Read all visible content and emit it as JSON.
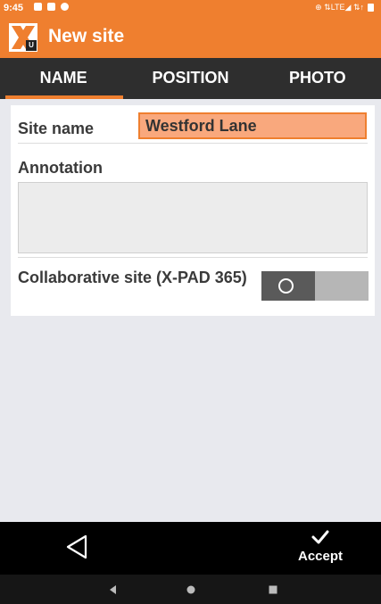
{
  "status_bar": {
    "time": "9:45",
    "right_text": "⊕ ⇅LTE◢ ⇅↑"
  },
  "app_bar": {
    "title": "New site",
    "logo_badge": "U"
  },
  "tabs": [
    {
      "label": "NAME",
      "active": true
    },
    {
      "label": "POSITION",
      "active": false
    },
    {
      "label": "PHOTO",
      "active": false
    }
  ],
  "form": {
    "site_name_label": "Site name",
    "site_name_value": "Westford Lane",
    "annotation_label": "Annotation",
    "annotation_value": "",
    "collaborative_label": "Collaborative site (X-PAD 365)",
    "collaborative_enabled": false
  },
  "actions": {
    "accept_label": "Accept",
    "back_icon": "back-triangle-icon",
    "accept_icon": "checkmark-icon"
  },
  "colors": {
    "brand_orange": "#ef7f2f",
    "input_highlight": "#f9a87d",
    "tab_bar": "#2e2e2e",
    "background": "#e8e9ee"
  }
}
